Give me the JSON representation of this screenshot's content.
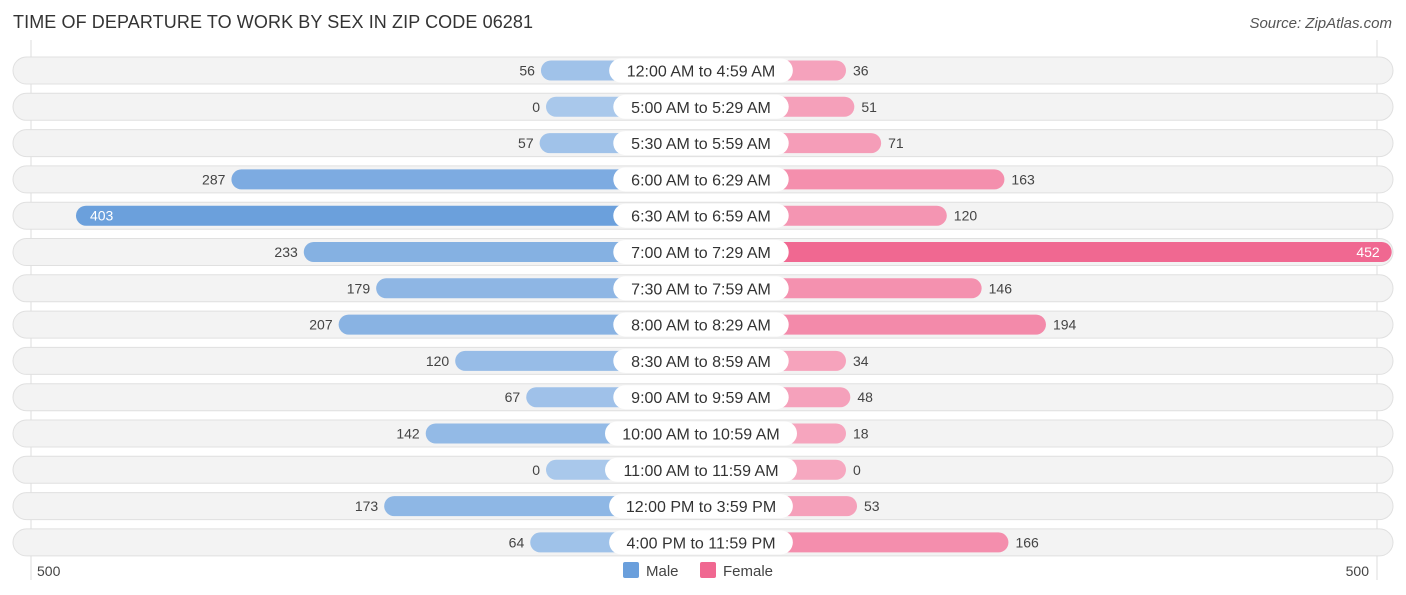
{
  "header": {
    "title": "TIME OF DEPARTURE TO WORK BY SEX IN ZIP CODE 06281",
    "source": "Source: ZipAtlas.com"
  },
  "colors": {
    "male": "#6a9fdc",
    "male_light": "#a9c8eb",
    "female": "#f06891",
    "female_light": "#f6a8c0",
    "row_background": "#f3f3f3"
  },
  "chart_data": {
    "type": "bar",
    "orientation": "horizontal-diverging",
    "title": "TIME OF DEPARTURE TO WORK BY SEX IN ZIP CODE 06281",
    "categories": [
      "12:00 AM to 4:59 AM",
      "5:00 AM to 5:29 AM",
      "5:30 AM to 5:59 AM",
      "6:00 AM to 6:29 AM",
      "6:30 AM to 6:59 AM",
      "7:00 AM to 7:29 AM",
      "7:30 AM to 7:59 AM",
      "8:00 AM to 8:29 AM",
      "8:30 AM to 8:59 AM",
      "9:00 AM to 9:59 AM",
      "10:00 AM to 10:59 AM",
      "11:00 AM to 11:59 AM",
      "12:00 PM to 3:59 PM",
      "4:00 PM to 11:59 PM"
    ],
    "series": [
      {
        "name": "Male",
        "values": [
          56,
          0,
          57,
          287,
          403,
          233,
          179,
          207,
          120,
          67,
          142,
          0,
          173,
          64
        ]
      },
      {
        "name": "Female",
        "values": [
          36,
          51,
          71,
          163,
          120,
          452,
          146,
          194,
          34,
          48,
          18,
          0,
          53,
          166
        ]
      }
    ],
    "axis": {
      "left_label": "500",
      "right_label": "500",
      "range": [
        -500,
        500
      ]
    },
    "legend": {
      "position": "bottom-center",
      "entries": [
        "Male",
        "Female"
      ]
    },
    "grid": false
  }
}
